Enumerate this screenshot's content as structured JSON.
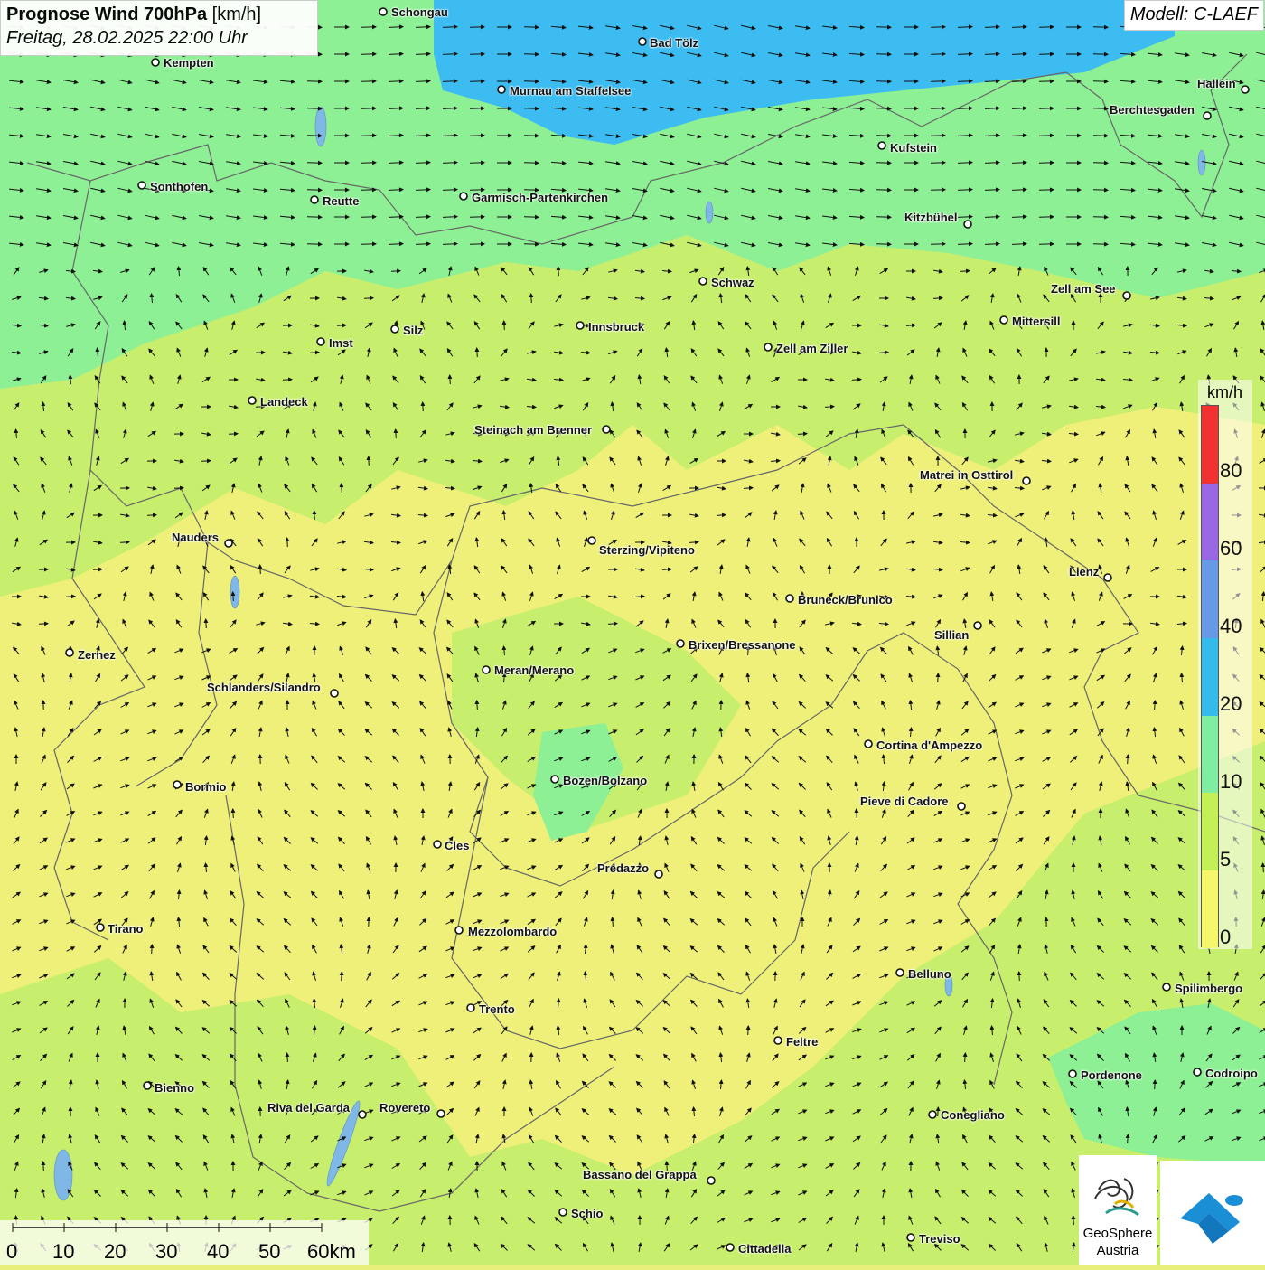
{
  "header": {
    "title_bold": "Prognose Wind 700hPa",
    "title_unit": "[km/h]",
    "datetime": "Freitag, 28.02.2025 22:00 Uhr",
    "model": "Modell: C-LAEF"
  },
  "legend": {
    "unit": "km/h",
    "labels": [
      "80",
      "60",
      "40",
      "20",
      "10",
      "5",
      "0"
    ],
    "colors": [
      "#f23232",
      "#9966e6",
      "#6699e6",
      "#33bbee",
      "#80eea0",
      "#c3f055",
      "#f6f66a"
    ]
  },
  "scale_bar": {
    "labels": [
      "0",
      "10",
      "20",
      "30",
      "40",
      "50",
      "60km"
    ]
  },
  "logos": {
    "geosphere_line1": "GeoSphere",
    "geosphere_line2": "Austria"
  },
  "cities": [
    {
      "name": "Schongau"
    },
    {
      "name": "Bad Tölz"
    },
    {
      "name": "Kempten"
    },
    {
      "name": "Murnau am Staffelsee"
    },
    {
      "name": "Hallein"
    },
    {
      "name": "Berchtesgaden"
    },
    {
      "name": "Kufstein"
    },
    {
      "name": "Sonthofen"
    },
    {
      "name": "Reutte"
    },
    {
      "name": "Garmisch-Partenkirchen"
    },
    {
      "name": "Kitzbühel"
    },
    {
      "name": "Schwaz"
    },
    {
      "name": "Zell am See"
    },
    {
      "name": "Mittersill"
    },
    {
      "name": "Innsbruck"
    },
    {
      "name": "Silz"
    },
    {
      "name": "Imst"
    },
    {
      "name": "Zell am Ziller"
    },
    {
      "name": "Landeck"
    },
    {
      "name": "Steinach am Brenner"
    },
    {
      "name": "Matrei in Osttirol"
    },
    {
      "name": "Nauders"
    },
    {
      "name": "Sterzing/Vipiteno"
    },
    {
      "name": "Lienz"
    },
    {
      "name": "Bruneck/Brunico"
    },
    {
      "name": "Sillian"
    },
    {
      "name": "Zernez"
    },
    {
      "name": "Brixen/Bressanone"
    },
    {
      "name": "Meran/Merano"
    },
    {
      "name": "Schlanders/Silandro"
    },
    {
      "name": "Cortina d'Ampezzo"
    },
    {
      "name": "Bozen/Bolzano"
    },
    {
      "name": "Bormio"
    },
    {
      "name": "Pieve di Cadore"
    },
    {
      "name": "Cles"
    },
    {
      "name": "Predazzo"
    },
    {
      "name": "Tirano"
    },
    {
      "name": "Mezzolombardo"
    },
    {
      "name": "Belluno"
    },
    {
      "name": "Spilimbergo"
    },
    {
      "name": "Trento"
    },
    {
      "name": "Feltre"
    },
    {
      "name": "Pordenone"
    },
    {
      "name": "Codroipo"
    },
    {
      "name": "Bienno"
    },
    {
      "name": "Riva del Garda"
    },
    {
      "name": "Rovereto"
    },
    {
      "name": "Conegliano"
    },
    {
      "name": "Bassano del Grappa"
    },
    {
      "name": "Schio"
    },
    {
      "name": "Treviso"
    },
    {
      "name": "Cittadella"
    }
  ]
}
